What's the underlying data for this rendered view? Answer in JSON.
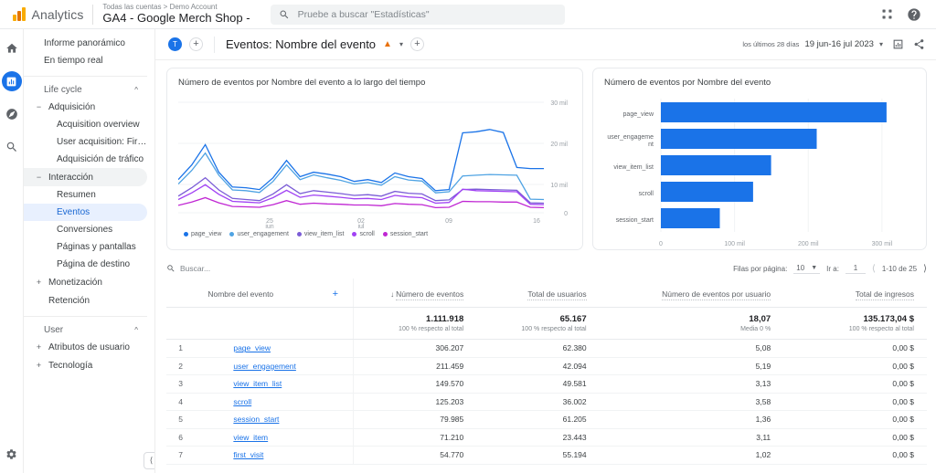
{
  "topbar": {
    "brand": "Analytics",
    "account_breadcrumb": "Todas las cuentas > Demo Account",
    "property_name": "GA4 - Google Merch Shop -",
    "search_placeholder": "Pruebe a buscar \"Estadísticas\"",
    "search_value": ""
  },
  "rail": [
    {
      "name": "home-icon",
      "label": "Inicio"
    },
    {
      "name": "reports-icon",
      "label": "Informes"
    },
    {
      "name": "explore-icon",
      "label": "Explorar"
    },
    {
      "name": "advertising-icon",
      "label": "Publicidad"
    }
  ],
  "sidebar": {
    "top_links": [
      {
        "label": "Informe panorámico"
      },
      {
        "label": "En tiempo real"
      }
    ],
    "groups": [
      {
        "label": "Life cycle",
        "collapse_icon": "chevron-up-icon",
        "items": [
          {
            "label": "Adquisición",
            "twisty": "−",
            "open": false,
            "children": [
              {
                "label": "Acquisition overview",
                "selected": false
              },
              {
                "label": "User acquisition: First user ...",
                "selected": false
              },
              {
                "label": "Adquisición de tráfico",
                "selected": false
              }
            ]
          },
          {
            "label": "Interacción",
            "twisty": "−",
            "open": true,
            "children": [
              {
                "label": "Resumen",
                "selected": false
              },
              {
                "label": "Eventos",
                "selected": true
              },
              {
                "label": "Conversiones",
                "selected": false
              },
              {
                "label": "Páginas y pantallas",
                "selected": false
              },
              {
                "label": "Página de destino",
                "selected": false
              }
            ]
          },
          {
            "label": "Monetización",
            "twisty": "+",
            "open": false,
            "children": []
          },
          {
            "label": "Retención",
            "twisty": "",
            "open": false,
            "children": []
          }
        ]
      },
      {
        "label": "User",
        "collapse_icon": "chevron-up-icon",
        "items": [
          {
            "label": "Atributos de usuario",
            "twisty": "+",
            "open": false,
            "children": []
          },
          {
            "label": "Tecnología",
            "twisty": "+",
            "open": false,
            "children": []
          }
        ]
      }
    ]
  },
  "page_header": {
    "tag_chip": "T",
    "add_comparison_label": "+",
    "title": "Eventos: Nombre del evento",
    "warning_icon": "warning-triangle-icon",
    "caret": "▾",
    "add_title_label": "+",
    "date_range_label": "los últimos 28 días",
    "date_range_value": "19 jun-16 jul 2023",
    "date_caret": "▾"
  },
  "chart_data": [
    {
      "type": "line",
      "title": "Número de eventos por Nombre del evento a lo largo del tiempo",
      "xlabel": "",
      "ylabel": "",
      "ylim": [
        0,
        30000
      ],
      "yticks": [
        "0",
        "10 mil",
        "20 mil",
        "30 mil"
      ],
      "xticks": [
        {
          "label": "25",
          "sublabel": "jun"
        },
        {
          "label": "02",
          "sublabel": "jul"
        },
        {
          "label": "09",
          "sublabel": ""
        },
        {
          "label": "16",
          "sublabel": ""
        }
      ],
      "grid": true,
      "legend_position": "bottom",
      "series": [
        {
          "name": "page_view",
          "color": "#1a73e8",
          "values": [
            9000,
            13000,
            18500,
            11000,
            7000,
            6800,
            6300,
            9500,
            14200,
            9800,
            11000,
            10500,
            9800,
            8500,
            9000,
            8200,
            10800,
            9800,
            9300,
            6000,
            6300,
            21700,
            22000,
            22600,
            21800,
            12300,
            12000,
            12000
          ]
        },
        {
          "name": "user_engagement",
          "color": "#4fa3e3",
          "values": [
            7800,
            11500,
            16200,
            10200,
            6200,
            6000,
            5500,
            8500,
            13000,
            9000,
            10300,
            9500,
            8800,
            7800,
            8200,
            7500,
            9800,
            8900,
            8600,
            5400,
            5700,
            10000,
            10200,
            10400,
            10300,
            10200,
            3700,
            3600
          ]
        },
        {
          "name": "view_item_list",
          "color": "#7b5cd6",
          "values": [
            4500,
            6800,
            9500,
            6200,
            3900,
            3600,
            3300,
            5100,
            7600,
            5200,
            6000,
            5600,
            5200,
            4700,
            4900,
            4500,
            5800,
            5300,
            5100,
            3300,
            3500,
            6300,
            6400,
            6300,
            6200,
            6100,
            2700,
            2600
          ]
        },
        {
          "name": "scroll",
          "color": "#a142f4",
          "values": [
            3600,
            5400,
            7600,
            5000,
            3100,
            2900,
            2700,
            4100,
            6100,
            4200,
            4800,
            4500,
            4200,
            3800,
            3900,
            3600,
            4700,
            4300,
            4100,
            2600,
            2800,
            6400,
            6000,
            5900,
            5800,
            5700,
            2300,
            2200
          ]
        },
        {
          "name": "session_start",
          "color": "#c026d3",
          "values": [
            2000,
            2900,
            4100,
            2700,
            1700,
            1600,
            1500,
            2200,
            3300,
            2300,
            2600,
            2400,
            2300,
            2100,
            2100,
            1900,
            2500,
            2300,
            2200,
            1400,
            1500,
            3100,
            3000,
            3000,
            2900,
            2900,
            1500,
            1400
          ]
        }
      ]
    },
    {
      "type": "bar",
      "orientation": "horizontal",
      "title": "Número de eventos por Nombre del evento",
      "categories": [
        "page_view",
        "user_engageme\nnt",
        "view_item_list",
        "scroll",
        "session_start"
      ],
      "values": [
        306207,
        211459,
        149570,
        125203,
        79985
      ],
      "bar_color": "#1a73e8",
      "xlim": [
        0,
        320000
      ],
      "xticks": [
        "0",
        "100 mil",
        "200 mil",
        "300 mil"
      ],
      "grid": true
    }
  ],
  "table": {
    "search_placeholder": "Buscar...",
    "search_value": "",
    "rows_per_page_label": "Filas por página:",
    "rows_per_page_value": "10",
    "goto_label": "Ir a:",
    "goto_value": "1",
    "range_label": "1-10 de 25",
    "dimension_header": "Nombre del evento",
    "add_dimension": "+",
    "sort_indicator": "↓",
    "metric_headers": [
      "Número de eventos",
      "Total de usuarios",
      "Número de eventos por usuario",
      "Total de ingresos"
    ],
    "totals": [
      {
        "value": "1.111.918",
        "sub": "100 % respecto al total"
      },
      {
        "value": "65.167",
        "sub": "100 % respecto al total"
      },
      {
        "value": "18,07",
        "sub": "Media 0 %"
      },
      {
        "value": "135.173,04 $",
        "sub": "100 % respecto al total"
      }
    ],
    "rows": [
      {
        "idx": "1",
        "name": "page_view",
        "events": "306.207",
        "users": "62.380",
        "per_user": "5,08",
        "revenue": "0,00 $"
      },
      {
        "idx": "2",
        "name": "user_engagement",
        "events": "211.459",
        "users": "42.094",
        "per_user": "5,19",
        "revenue": "0,00 $"
      },
      {
        "idx": "3",
        "name": "view_item_list",
        "events": "149.570",
        "users": "49.581",
        "per_user": "3,13",
        "revenue": "0,00 $"
      },
      {
        "idx": "4",
        "name": "scroll",
        "events": "125.203",
        "users": "36.002",
        "per_user": "3,58",
        "revenue": "0,00 $"
      },
      {
        "idx": "5",
        "name": "session_start",
        "events": "79.985",
        "users": "61.205",
        "per_user": "1,36",
        "revenue": "0,00 $"
      },
      {
        "idx": "6",
        "name": "view_item",
        "events": "71.210",
        "users": "23.443",
        "per_user": "3,11",
        "revenue": "0,00 $"
      },
      {
        "idx": "7",
        "name": "first_visit",
        "events": "54.770",
        "users": "55.194",
        "per_user": "1,02",
        "revenue": "0,00 $"
      }
    ]
  },
  "footer": {
    "settings_icon": "gear-icon",
    "collapse_icon": "collapse-panel-icon"
  },
  "colors": {
    "accent": "#1a73e8",
    "selected_bg": "#e8f0fe",
    "warning": "#e8710a"
  }
}
